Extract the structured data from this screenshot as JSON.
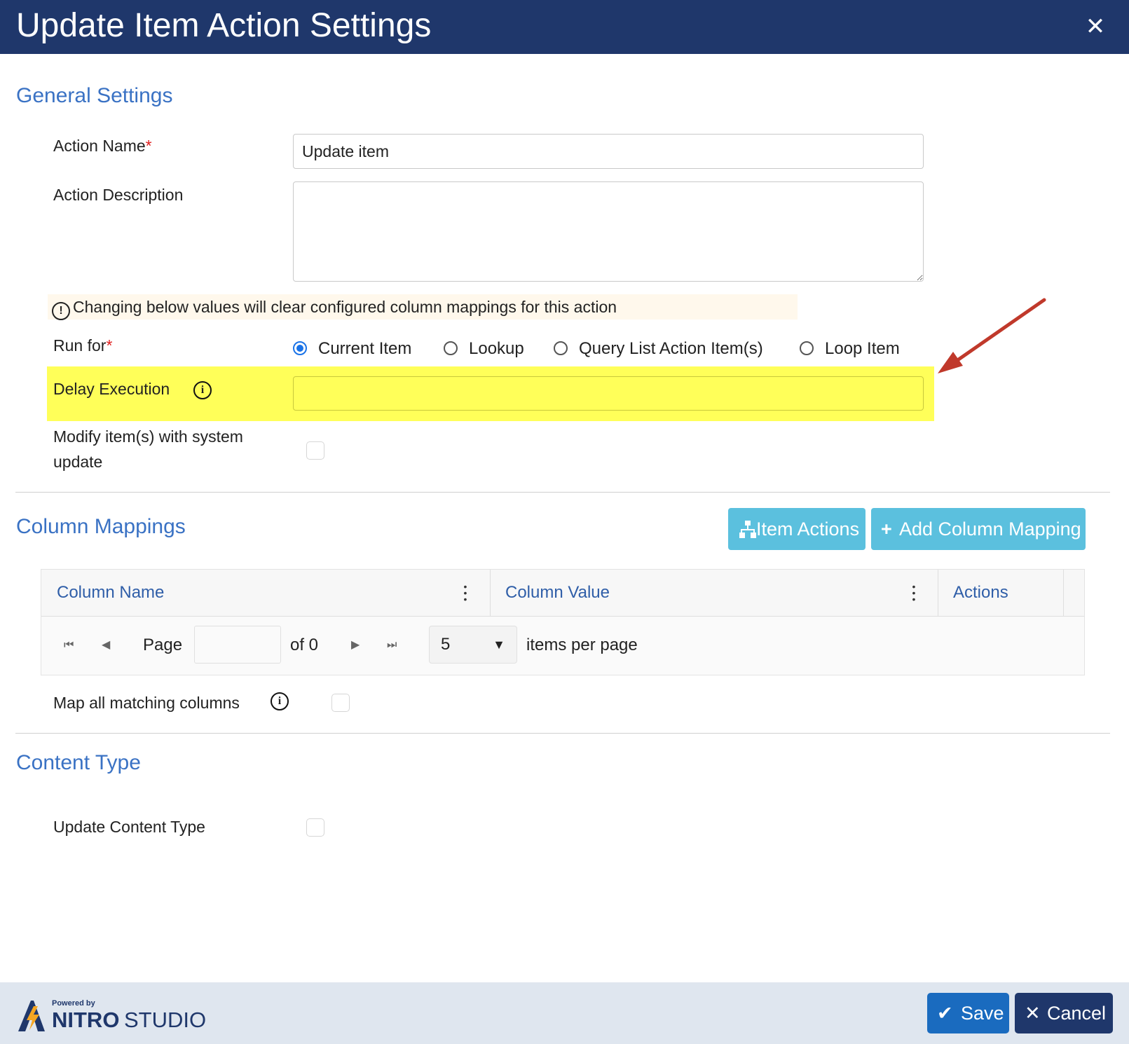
{
  "dialog": {
    "title": "Update Item Action Settings",
    "close_glyph": "✕"
  },
  "general": {
    "section_title": "General Settings",
    "action_name_label": "Action Name",
    "required_mark": "*",
    "action_name_value": "Update item",
    "action_description_label": "Action Description",
    "action_description_value": "",
    "warning_icon": "!",
    "warning_text": "Changing below values will clear configured column mappings for this action",
    "run_for_label": "Run for",
    "run_for_options": [
      {
        "label": "Current Item",
        "selected": true
      },
      {
        "label": "Lookup",
        "selected": false
      },
      {
        "label": "Query List Action Item(s)",
        "selected": false
      },
      {
        "label": "Loop Item",
        "selected": false
      }
    ],
    "delay_execution_label": "Delay Execution",
    "delay_execution_value": "",
    "info_icon": "i",
    "modify_system_update_label_line1": "Modify item(s) with system",
    "modify_system_update_label_line2": "update",
    "modify_system_update_checked": false
  },
  "column_mappings": {
    "section_title": "Column Mappings",
    "item_actions_label": "Item Actions",
    "add_mapping_icon": "+",
    "add_mapping_label": "Add Column Mapping",
    "columns": [
      "Column Name",
      "Column Value",
      "Actions"
    ],
    "pager": {
      "first": "⏮",
      "prev": "◀",
      "page_label": "Page",
      "page_value": "",
      "of_label": "of 0",
      "next": "▶",
      "last": "⏭",
      "page_size": "5",
      "caret": "▼",
      "items_per_page_label": "items per page"
    },
    "map_all_label": "Map all matching columns",
    "map_all_checked": false
  },
  "content_type": {
    "section_title": "Content Type",
    "update_label": "Update Content Type",
    "update_checked": false
  },
  "footer": {
    "powered_by": "Powered by",
    "brand_nitro": "NITRO",
    "brand_studio": "STUDIO",
    "save_icon": "✔",
    "save_label": "Save",
    "cancel_icon": "✕",
    "cancel_label": "Cancel"
  },
  "colors": {
    "header_bg": "#1f376b",
    "section_title": "#3a72c4",
    "highlight": "#ffff59",
    "info_button": "#5bc0de",
    "save_button": "#1a6bbf",
    "cancel_button": "#1f376b",
    "annotation_arrow": "#c0392b"
  }
}
